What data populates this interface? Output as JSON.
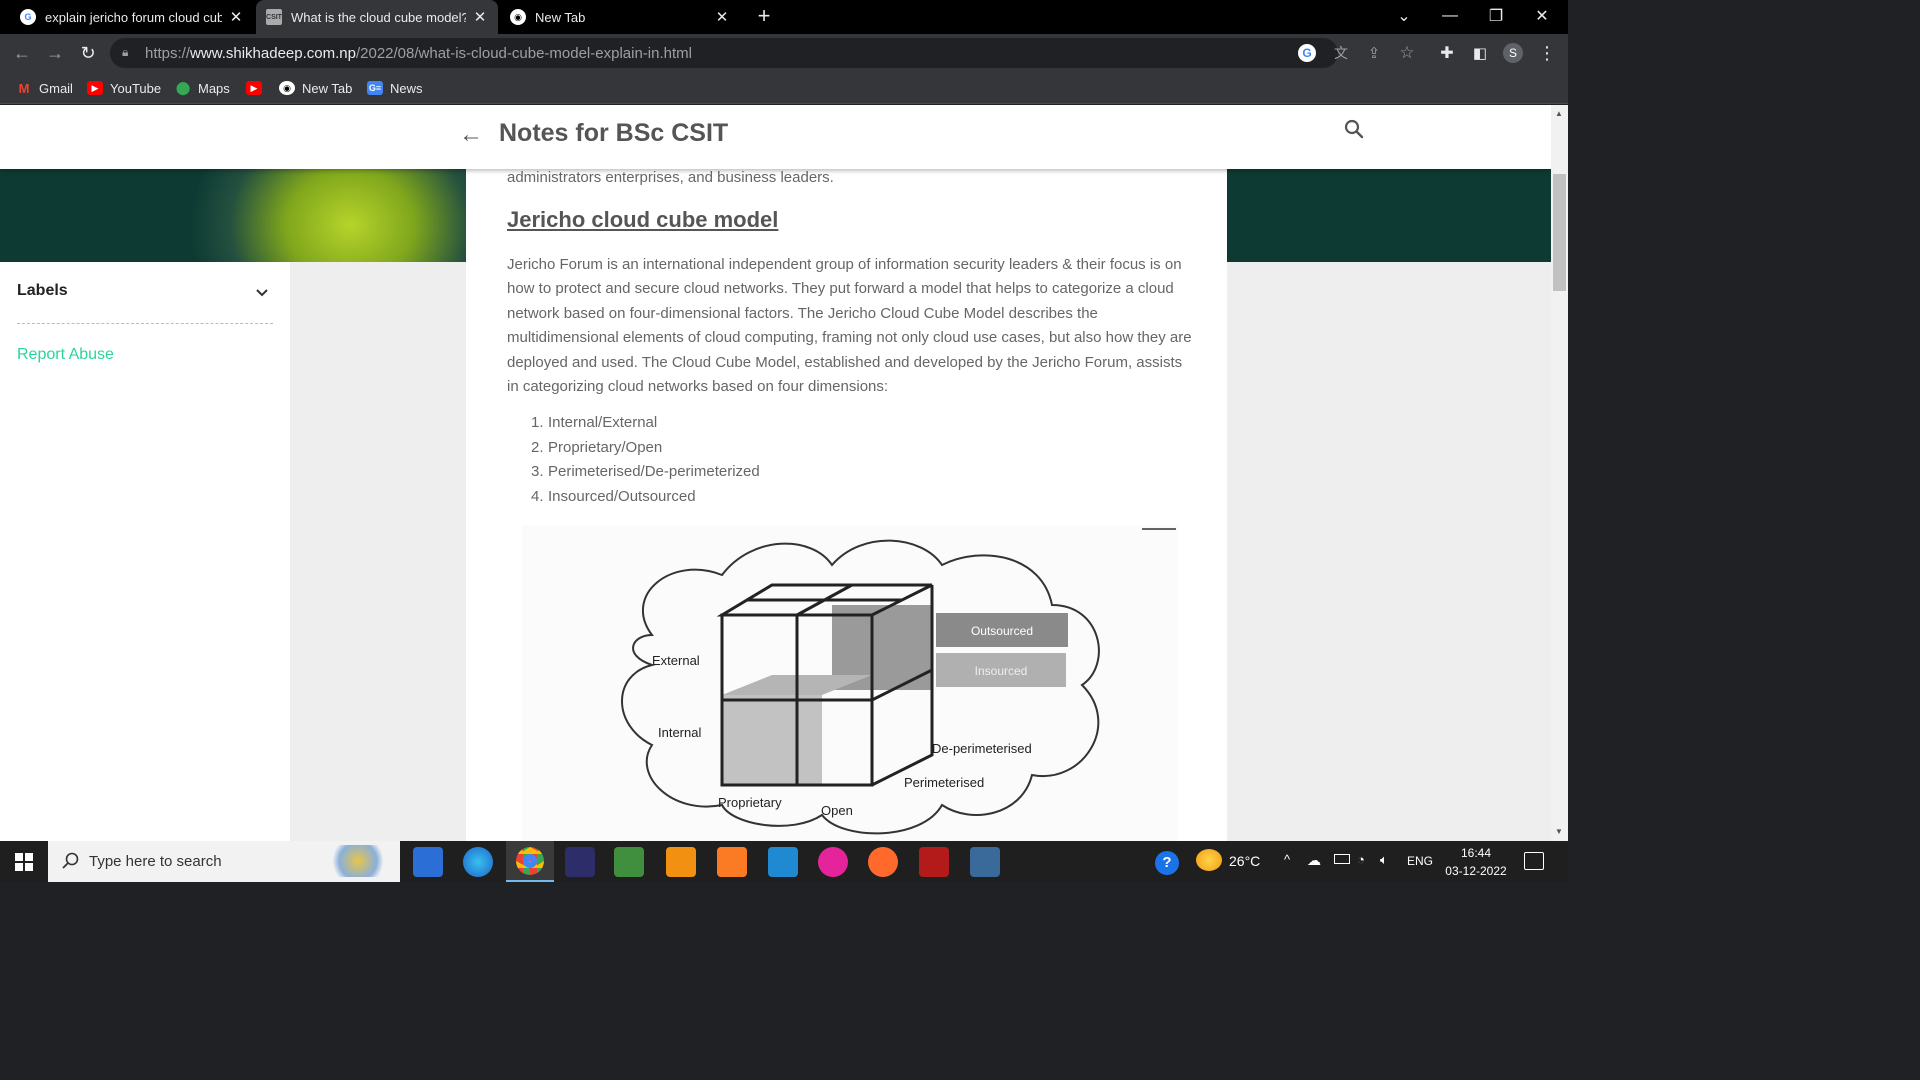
{
  "browser": {
    "tabs": [
      {
        "title": "explain jericho forum cloud cube",
        "favicon": "google-icon",
        "active": false
      },
      {
        "title": "What is the cloud cube model? E",
        "favicon": "csit-icon",
        "active": true
      },
      {
        "title": "New Tab",
        "favicon": "chrome-icon",
        "active": false
      }
    ],
    "new_tab_glyph": "+",
    "url_prefix": "https://",
    "url_host": "www.shikhadeep.com.np",
    "url_path": "/2022/08/what-is-cloud-cube-model-explain-in.html",
    "profile_initial": "S",
    "bookmarks": [
      {
        "label": "Gmail",
        "icon": "gmail-icon"
      },
      {
        "label": "YouTube",
        "icon": "youtube-icon"
      },
      {
        "label": "Maps",
        "icon": "maps-icon"
      },
      {
        "label": "",
        "icon": "youtube-icon"
      },
      {
        "label": "New Tab",
        "icon": "chrome-icon"
      },
      {
        "label": "News",
        "icon": "news-icon"
      }
    ]
  },
  "site": {
    "title": "Notes for BSc CSIT"
  },
  "sidebar": {
    "labels_title": "Labels",
    "report_abuse": "Report Abuse"
  },
  "article": {
    "intro_tail": "administrators enterprises, and business leaders.",
    "heading": "Jericho cloud cube model",
    "paragraph": "Jericho Forum is an international independent group of information security leaders & their focus is on how to protect and secure cloud networks. They put forward a model that helps to categorize a cloud network based on four-dimensional factors. The Jericho Cloud Cube Model describes the multidimensional elements of cloud computing, framing not only cloud use cases, but also how they are deployed and used. The Cloud Cube Model, established and developed by the Jericho Forum, assists in categorizing cloud networks based on four dimensions:",
    "dimensions": [
      {
        "num": "1.",
        "text": "Internal/External"
      },
      {
        "num": "2.",
        "text": "Proprietary/Open"
      },
      {
        "num": "3.",
        "text": "Perimeterised/De-perimeterized"
      },
      {
        "num": "4.",
        "text": "Insourced/Outsourced"
      }
    ],
    "figure_labels": {
      "outsourced": "Outsourced",
      "insourced": "Insourced",
      "external": "External",
      "internal": "Internal",
      "deperimeterised": "De-perimeterised",
      "perimeterised": "Perimeterised",
      "proprietary": "Proprietary",
      "open": "Open"
    }
  },
  "taskbar": {
    "search_placeholder": "Type here to search",
    "temperature": "26°C",
    "language": "ENG",
    "time": "16:44",
    "date": "03-12-2022"
  },
  "colors": {
    "accent_link": "#2bd59a",
    "header_text": "#555555",
    "body_text": "#666666"
  }
}
